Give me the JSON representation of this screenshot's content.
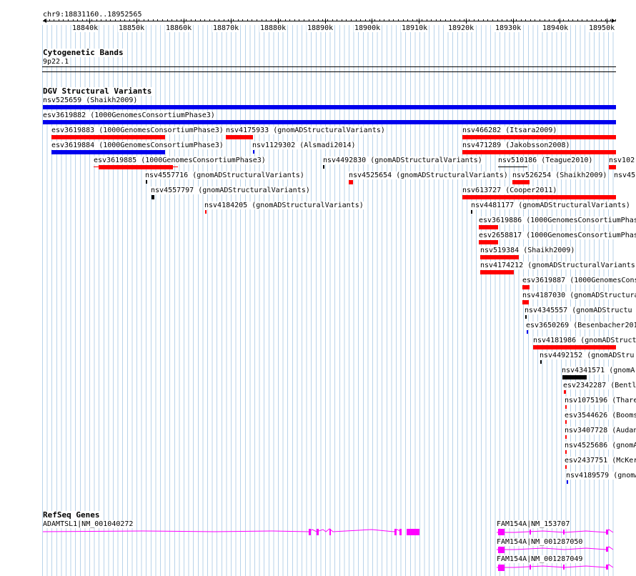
{
  "ruler": {
    "position": "chr9:18831160..18952565",
    "labels": [
      "18840k",
      "18850k",
      "18860k",
      "18870k",
      "18880k",
      "18890k",
      "18900k",
      "18910k",
      "18920k",
      "18930k",
      "18940k",
      "18950k"
    ]
  },
  "cytoband": {
    "title": "Cytogenetic Bands",
    "band": "9p22.1"
  },
  "dgv": {
    "title": "DGV Structural Variants",
    "labels": [
      "nsv525659 (Shaikh2009)",
      "esv3619882 (1000GenomesConsortiumPhase3)",
      "esv3619883 (1000GenomesConsortiumPhase3)",
      "nsv4175933 (gnomADStructuralVariants)",
      "nsv466282 (Itsara2009)",
      "esv3619884 (1000GenomesConsortiumPhase3)",
      "nsv1129302 (Alsmadi2014)",
      "nsv471289 (Jakobsson2008)",
      "esv3619885 (1000GenomesConsortiumPhase3)",
      "nsv4492830 (gnomADStructuralVariants)",
      "nsv510186 (Teague2010)",
      "nsv102",
      "nsv4557716 (gnomADStructuralVariants)",
      "nsv4525654 (gnomADStructuralVariants)",
      "nsv526254 (Shaikh2009)",
      "nsv45",
      "nsv4557797 (gnomADStructuralVariants)",
      "nsv613727 (Cooper2011)",
      "nsv4184205 (gnomADStructuralVariants)",
      "nsv4481177 (gnomADStructuralVariants)",
      "esv3619886 (1000GenomesConsortiumPhas",
      "esv2658817 (1000GenomesConsortiumPhas",
      "nsv519384 (Shaikh2009)",
      "nsv4174212 (gnomADStructuralVariants",
      "esv3619887 (1000GenomesCons",
      "nsv4187030 (gnomADStructura",
      "nsv4345557 (gnomADStructu",
      "esv3650269 (Besenbacher201",
      "nsv4181986 (gnomADStruct",
      "nsv4492152 (gnomADStru",
      "nsv4341571 (gnomA",
      "esv2342287 (Bentl",
      "nsv1075196 (Thare",
      "esv3544626 (Booms",
      "nsv3407728 (Audan",
      "nsv4525686 (gnomA",
      "esv2437751 (McKer",
      "nsv4189579 (gnomA"
    ]
  },
  "refseq": {
    "title": "RefSeq Genes",
    "genes": [
      "ADAMTSL1|NM_001040272",
      "FAM154A|NM_153707",
      "FAM154A|NM_001287050",
      "FAM154A|NM_001287049"
    ]
  },
  "colors": {
    "loss": "#ff0000",
    "gain": "#0000ee",
    "complex": "#000000",
    "gene": "#ff00ff",
    "grid": "#b9d3ea"
  }
}
